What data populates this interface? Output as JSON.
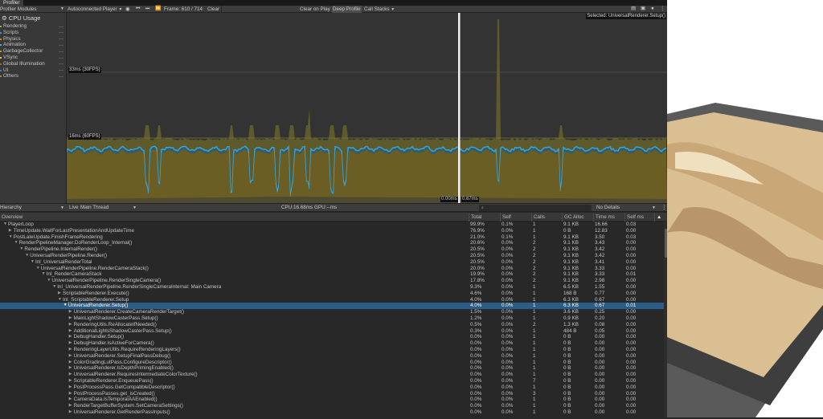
{
  "window": {
    "tab": "Profiler"
  },
  "toolbar": {
    "modules": "Profiler Modules",
    "player": "Autoconnected Player",
    "frame": "Frame: 610 / 714",
    "clear": "Clear",
    "clear_on_play": "Clear on Play",
    "deep_profile": "Deep Profile",
    "call_stacks": "Call Stacks"
  },
  "cpu_module": {
    "title": "CPU Usage",
    "categories": [
      {
        "label": "Rendering",
        "color": "#9bb32c"
      },
      {
        "label": "Scripts",
        "color": "#3b8fd1"
      },
      {
        "label": "Physics",
        "color": "#e07a1f"
      },
      {
        "label": "Animation",
        "color": "#3ab5c8"
      },
      {
        "label": "GarbageCollector",
        "color": "#c79a36"
      },
      {
        "label": "VSync",
        "color": "#d8c81f"
      },
      {
        "label": "Global Illumination",
        "color": "#c9502a"
      },
      {
        "label": "UI",
        "color": "#4a7cc0"
      },
      {
        "label": "Others",
        "color": "#aa8a3a"
      }
    ]
  },
  "chart": {
    "line_33": "33ms (30FPS)",
    "line_16": "16ms (60FPS)",
    "selected": "Selected: UniversalRenderer.Setup()",
    "marker_a": "0.00ms",
    "marker_b": "0.67ms"
  },
  "details": {
    "view": "Hierarchy",
    "live": "Live",
    "thread": "Main Thread",
    "cpu": "CPU:16.68ms",
    "gpu": "GPU:--ms",
    "details_mode": "No Details"
  },
  "table": {
    "columns": [
      "Overview",
      "Total",
      "Self",
      "Calls",
      "GC Alloc",
      "Time ms",
      "Self ms"
    ],
    "rows": [
      {
        "name": "PlayerLoop",
        "depth": 0,
        "open": true,
        "v": [
          "99.9%",
          "0.1%",
          "1",
          "9.1 KB",
          "16.66",
          "0.03"
        ]
      },
      {
        "name": "TimeUpdate.WaitForLastPresentationAndUpdateTime",
        "depth": 1,
        "open": false,
        "v": [
          "76.9%",
          "0.0%",
          "1",
          "0 B",
          "12.83",
          "0.00"
        ]
      },
      {
        "name": "PostLateUpdate.FinishFrameRendering",
        "depth": 1,
        "open": true,
        "v": [
          "21.0%",
          "0.1%",
          "1",
          "9.1 KB",
          "3.50",
          "0.03"
        ]
      },
      {
        "name": "RenderPipelineManager.DoRenderLoop_Internal()",
        "depth": 2,
        "open": true,
        "v": [
          "20.6%",
          "0.0%",
          "2",
          "9.1 KB",
          "3.43",
          "0.00"
        ]
      },
      {
        "name": "RenderPipeline.InternalRender()",
        "depth": 3,
        "open": true,
        "v": [
          "20.5%",
          "0.0%",
          "2",
          "9.1 KB",
          "3.42",
          "0.00"
        ]
      },
      {
        "name": "UniversalRenderPipeline.Render()",
        "depth": 4,
        "open": true,
        "v": [
          "20.5%",
          "0.0%",
          "2",
          "9.1 KB",
          "3.42",
          "0.00"
        ]
      },
      {
        "name": "Inl_UniversalRenderTotal",
        "depth": 5,
        "open": true,
        "v": [
          "20.5%",
          "0.0%",
          "2",
          "9.1 KB",
          "3.41",
          "0.00"
        ]
      },
      {
        "name": "UniversalRenderPipeline.RenderCameraStack()",
        "depth": 6,
        "open": true,
        "v": [
          "20.0%",
          "0.0%",
          "2",
          "9.1 KB",
          "3.33",
          "0.00"
        ]
      },
      {
        "name": "Inl_RenderCameraStack",
        "depth": 7,
        "open": true,
        "v": [
          "19.9%",
          "0.0%",
          "2",
          "9.1 KB",
          "3.33",
          "0.01"
        ]
      },
      {
        "name": "UniversalRenderPipeline.RenderSingleCamera()",
        "depth": 8,
        "open": true,
        "v": [
          "17.8%",
          "0.0%",
          "2",
          "9.1 KB",
          "2.98",
          "0.00"
        ]
      },
      {
        "name": "Inl_UniversalRenderPipeline.RenderSingleCameraInternal: Main Camera",
        "depth": 9,
        "open": true,
        "v": [
          "9.3%",
          "0.0%",
          "1",
          "6.5 KB",
          "1.55",
          "0.00"
        ]
      },
      {
        "name": "ScriptableRenderer.Execute()",
        "depth": 10,
        "open": false,
        "v": [
          "4.6%",
          "0.0%",
          "1",
          "168 B",
          "0.77",
          "0.00"
        ]
      },
      {
        "name": "Inl_ScriptableRenderer.Setup",
        "depth": 10,
        "open": true,
        "v": [
          "4.0%",
          "0.0%",
          "1",
          "6.3 KB",
          "0.67",
          "0.00"
        ]
      },
      {
        "name": "UniversalRenderer.Setup()",
        "depth": 11,
        "open": true,
        "sel": true,
        "v": [
          "4.0%",
          "0.0%",
          "1",
          "6.3 KB",
          "0.67",
          "0.01"
        ]
      },
      {
        "name": "UniversalRenderer.CreateCameraRenderTarget()",
        "depth": 12,
        "open": false,
        "v": [
          "1.5%",
          "0.0%",
          "1",
          "3.6 KB",
          "0.25",
          "0.00"
        ]
      },
      {
        "name": "MainLightShadowCasterPass.Setup()",
        "depth": 12,
        "open": false,
        "v": [
          "1.2%",
          "0.0%",
          "1",
          "0.9 KB",
          "0.20",
          "0.00"
        ]
      },
      {
        "name": "RenderingUtils.ReAllocateIfNeeded()",
        "depth": 12,
        "open": false,
        "v": [
          "0.5%",
          "0.0%",
          "2",
          "1.3 KB",
          "0.08",
          "0.00"
        ]
      },
      {
        "name": "AdditionalLightsShadowCasterPass.Setup()",
        "depth": 12,
        "open": false,
        "v": [
          "0.3%",
          "0.0%",
          "1",
          "484 B",
          "0.05",
          "0.00"
        ]
      },
      {
        "name": "DebugHandler.Setup()",
        "depth": 12,
        "open": false,
        "v": [
          "0.0%",
          "0.0%",
          "1",
          "0 B",
          "0.00",
          "0.00"
        ]
      },
      {
        "name": "DebugHandler.IsActiveForCamera()",
        "depth": 12,
        "open": false,
        "v": [
          "0.0%",
          "0.0%",
          "1",
          "0 B",
          "0.00",
          "0.00"
        ]
      },
      {
        "name": "RenderingLayerUtils.RequireRenderingLayers()",
        "depth": 12,
        "open": false,
        "v": [
          "0.0%",
          "0.0%",
          "1",
          "0 B",
          "0.00",
          "0.00"
        ]
      },
      {
        "name": "UniversalRenderer.SetupFinalPassDebug()",
        "depth": 12,
        "open": false,
        "v": [
          "0.0%",
          "0.0%",
          "1",
          "0 B",
          "0.00",
          "0.00"
        ]
      },
      {
        "name": "ColorGradingLutPass.ConfigureDescriptor()",
        "depth": 12,
        "open": false,
        "v": [
          "0.0%",
          "0.0%",
          "1",
          "0 B",
          "0.00",
          "0.00"
        ]
      },
      {
        "name": "UniversalRenderer.IsDepthPrimingEnabled()",
        "depth": 12,
        "open": false,
        "v": [
          "0.0%",
          "0.0%",
          "1",
          "0 B",
          "0.00",
          "0.00"
        ]
      },
      {
        "name": "UniversalRenderer.RequiresIntermediateColorTexture()",
        "depth": 12,
        "open": false,
        "v": [
          "0.0%",
          "0.0%",
          "1",
          "0 B",
          "0.00",
          "0.00"
        ]
      },
      {
        "name": "ScriptableRenderer.EnqueuePass()",
        "depth": 12,
        "open": false,
        "v": [
          "0.0%",
          "0.0%",
          "7",
          "0 B",
          "0.00",
          "0.00"
        ]
      },
      {
        "name": "PostProcessPass.GetCompatibleDescriptor()",
        "depth": 12,
        "open": false,
        "v": [
          "0.0%",
          "0.0%",
          "1",
          "0 B",
          "0.00",
          "0.00"
        ]
      },
      {
        "name": "PostProcessPasses.get_isCreated()",
        "depth": 12,
        "open": false,
        "v": [
          "0.0%",
          "0.0%",
          "3",
          "0 B",
          "0.00",
          "0.00"
        ]
      },
      {
        "name": "CameraData.IsTemporalAAEnabled()",
        "depth": 12,
        "open": false,
        "v": [
          "0.0%",
          "0.0%",
          "1",
          "0 B",
          "0.00",
          "0.00"
        ]
      },
      {
        "name": "RenderTargetBufferSystem.SetCameraSettings()",
        "depth": 12,
        "open": false,
        "v": [
          "0.0%",
          "0.0%",
          "1",
          "0 B",
          "0.00",
          "0.00"
        ]
      },
      {
        "name": "UniversalRenderer.GetRenderPassInputs()",
        "depth": 12,
        "open": false,
        "v": [
          "0.0%",
          "0.0%",
          "1",
          "0 B",
          "0.00",
          "0.00"
        ]
      }
    ]
  }
}
